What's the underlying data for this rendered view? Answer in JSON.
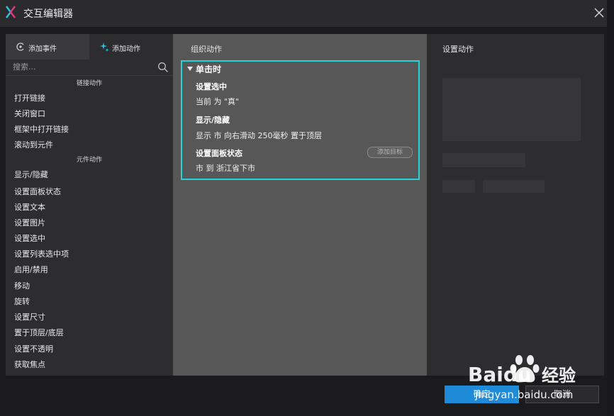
{
  "window": {
    "title": "交互编辑器"
  },
  "left_panel": {
    "tabs": [
      {
        "label": "添加事件",
        "icon": "event-icon"
      },
      {
        "label": "添加动作",
        "icon": "sparkle-action-icon"
      }
    ],
    "search": {
      "placeholder": "搜索..."
    },
    "sections": [
      {
        "header": "链接动作",
        "items": [
          "打开链接",
          "关闭窗口",
          "框架中打开链接",
          "滚动到元件"
        ]
      },
      {
        "header": "元件动作",
        "items": [
          "显示/隐藏",
          "设置面板状态",
          "设置文本",
          "设置图片",
          "设置选中",
          "设置列表选中项",
          "启用/禁用",
          "移动",
          "旋转",
          "设置尺寸",
          "置于顶层/底层",
          "设置不透明",
          "获取焦点"
        ]
      }
    ]
  },
  "middle_panel": {
    "title": "组织动作",
    "case_name": "单击时",
    "actions": [
      {
        "title": "设置选中",
        "description": "当前 为 \"真\""
      },
      {
        "title": "显示/隐藏",
        "description": "显示 市 向右滑动 250毫秒 置于顶层"
      },
      {
        "title": "设置面板状态",
        "description": "市 到 浙江省下市"
      }
    ],
    "add_target_label": "添加目标"
  },
  "right_panel": {
    "title": "设置动作"
  },
  "footer": {
    "ok_label": "确定",
    "cancel_label": "取消"
  },
  "watermark": {
    "brand": "Baidu",
    "suffix": "经验",
    "url": "jingyan.baidu.com"
  },
  "colors": {
    "accent": "#1f8ad8",
    "case_border": "#25d4d4",
    "logo_teal": "#25c7e0",
    "logo_pink": "#e03a7e"
  }
}
